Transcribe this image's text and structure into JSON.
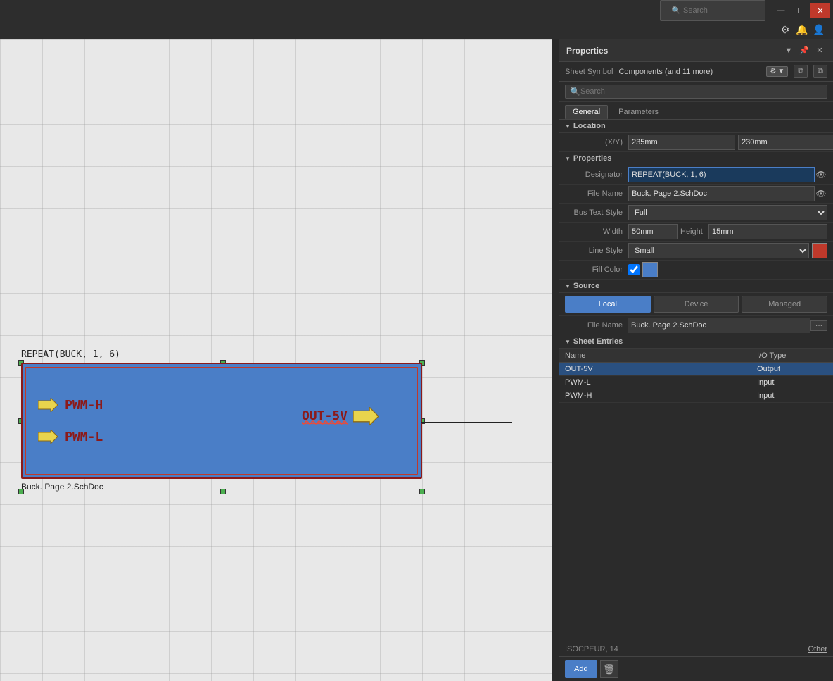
{
  "titlebar": {
    "search_placeholder": "Search",
    "minimize": "—",
    "maximize": "☐",
    "close": "✕"
  },
  "canvas": {
    "component_name": "REPEAT(BUCK, 1, 6)",
    "file_label": "Buck. Page 2.SchDoc",
    "pin_pwm_h": "PWM-H",
    "pin_pwm_l": "PWM-L",
    "pin_out_5v": "OUT-5V"
  },
  "properties": {
    "panel_title": "Properties",
    "sheet_symbol_label": "Sheet Symbol",
    "components_label": "Components (and 11 more)",
    "filter_label": "▼",
    "search_placeholder": "Search",
    "tabs": {
      "general": "General",
      "parameters": "Parameters"
    },
    "location": {
      "section": "Location",
      "xy_label": "(X/Y)",
      "x_value": "235mm",
      "y_value": "230mm"
    },
    "properties_section": {
      "section": "Properties",
      "designator_label": "Designator",
      "designator_value": "REPEAT(BUCK, 1, 6)",
      "file_name_label": "File Name",
      "file_name_value": "Buck. Page 2.SchDoc",
      "bus_text_label": "Bus Text Style",
      "bus_text_value": "Full",
      "width_label": "Width",
      "width_value": "50mm",
      "height_label": "Height",
      "height_value": "15mm",
      "line_style_label": "Line Style",
      "line_style_value": "Small",
      "fill_color_label": "Fill Color"
    },
    "source": {
      "section": "Source",
      "local_btn": "Local",
      "device_btn": "Device",
      "managed_btn": "Managed",
      "file_name_label": "File Name",
      "file_name_value": "Buck. Page 2.SchDoc"
    },
    "sheet_entries": {
      "section": "Sheet Entries",
      "col_name": "Name",
      "col_iotype": "I/O Type",
      "rows": [
        {
          "name": "OUT-5V",
          "iotype": "Output",
          "selected": true
        },
        {
          "name": "PWM-L",
          "iotype": "Input",
          "selected": false
        },
        {
          "name": "PWM-H",
          "iotype": "Input",
          "selected": false
        }
      ]
    },
    "footer": {
      "info_label": "ISOCPEUR, 14",
      "other_label": "Other",
      "add_btn": "Add",
      "delete_icon": "🗑"
    }
  }
}
